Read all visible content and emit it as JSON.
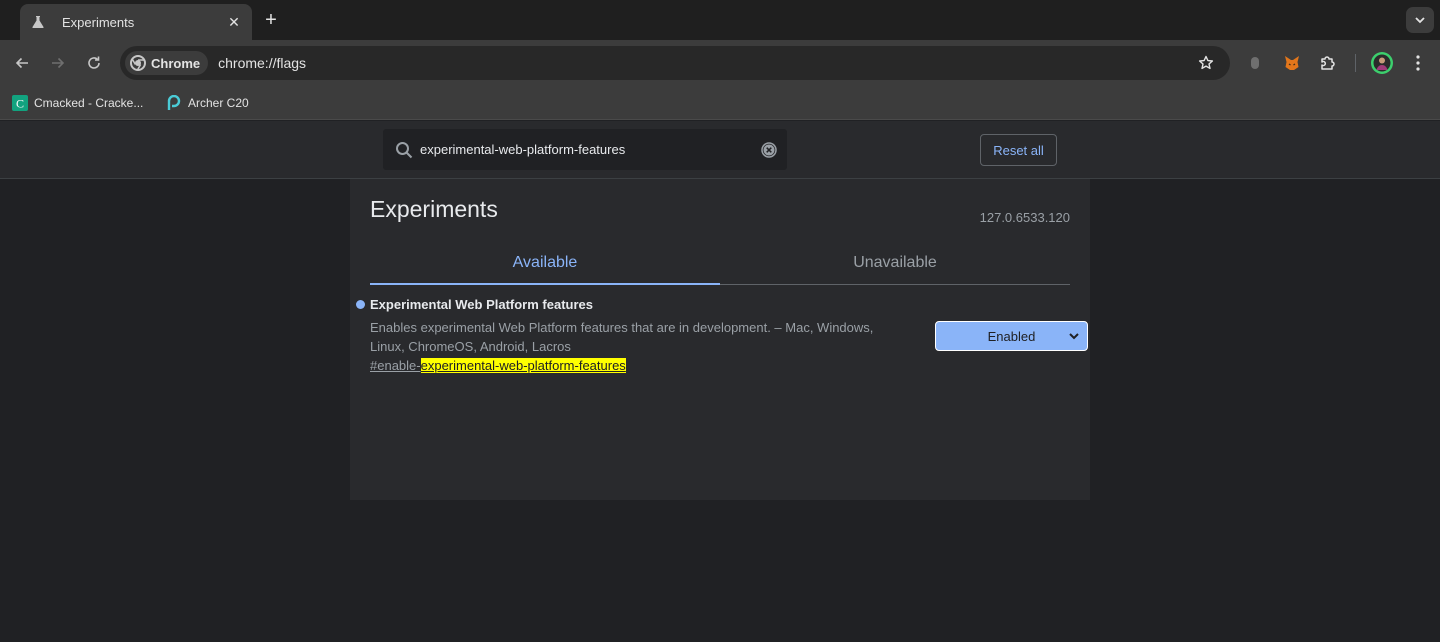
{
  "browser": {
    "tab": {
      "title": "Experiments"
    },
    "omnibox": {
      "chip_label": "Chrome",
      "url": "chrome://flags"
    },
    "bookmarks": [
      {
        "label": "Cmacked - Cracke..."
      },
      {
        "label": "Archer C20"
      }
    ]
  },
  "flags_header": {
    "search_value": "experimental-web-platform-features",
    "reset_label": "Reset all"
  },
  "page": {
    "title": "Experiments",
    "version": "127.0.6533.120",
    "tabs": [
      {
        "label": "Available",
        "active": true
      },
      {
        "label": "Unavailable",
        "active": false
      }
    ]
  },
  "flag": {
    "name": "Experimental Web Platform features",
    "description": "Enables experimental Web Platform features that are in development. – Mac, Windows, Linux, ChromeOS, Android, Lacros",
    "permalink_prefix": "#enable-",
    "permalink_match": "experimental-web-platform-features",
    "selected_option": "Enabled"
  },
  "colors": {
    "accent": "#8ab4f8",
    "highlight": "#ffff00",
    "background": "#202124"
  }
}
